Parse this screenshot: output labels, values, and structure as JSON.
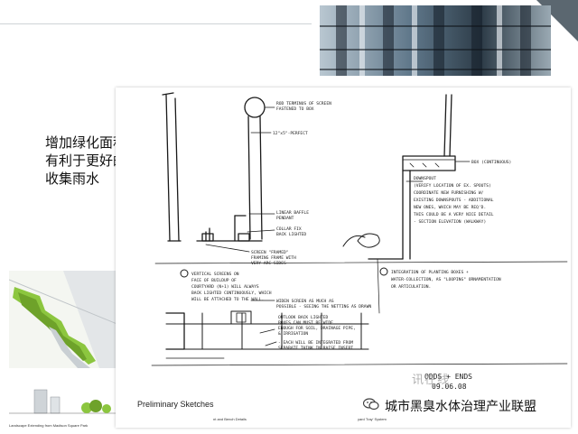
{
  "slide": {
    "caption_lines": [
      "增加绿化面积",
      "有利于更好的",
      "收集雨水"
    ],
    "sketch_notes": {
      "n1": "ROD TERMINUS OF SCREEN",
      "n1b": "FASTENED TO BOX",
      "n2": "12\"x5\"-PERFECT",
      "n3": "LINEAR BAFFLE",
      "n3b": "PENDANT",
      "n4": "COLLAR FIX",
      "n4b": "BACK LIGHTED",
      "n5": "SCREEN \"FRAMED\"",
      "n5b": "FRAMING FRAME WITH",
      "n5c": "VERY ARC SIDES",
      "n6": "BOX (CONTINUOUS)",
      "n7": "DOWNSPOUT",
      "n7b": "(VERIFY LOCATION OF EX. SPOUTS)",
      "n7c": "COORDINATE NEW FURNISHING W/",
      "n7d": "EXISTING DOWNSPOUTS - ADDITIONAL",
      "n7e": "NEW ONES, WHICH MAY BE REQ'D.",
      "n7f": "THIS COULD BE A VERY NICE DETAIL",
      "n7g": "- SECTION ELEVATION (WALKWAY)",
      "n8": "VERTICAL SCREENS ON",
      "n8b": "FACE OF BUILDUP OF",
      "n8c": "COURTYARD (N+1) WILL ALWAYS",
      "n8d": "BACK LIGHTED CONTINUOUSLY, WHICH",
      "n8e": "WILL BE ATTACHED TO THE WALL.",
      "n9": "INTEGRATION OF PLANTING BOXES +",
      "n9b": "WATER-COLLECTION, AS \"LOOPING\" ORNAMENTATION",
      "n9c": "OR ARTICULATION.",
      "n10": "WIDEN SCREEN AS MUCH AS",
      "n10b": "POSSIBLE - SEEING THE NETTING AS DRAWN",
      "n11": "OUTLOOK BACK LIGHTED",
      "n11b": "BOXES CAN MUST BE WIDE",
      "n11c": "ENOUGH FOR SOIL, DRAINAGE PIPE,",
      "n11d": "& IRRIGATION",
      "n12": "- EACH WILL BE INTEGRATED FROM",
      "n12b": "SEPARATE THINK IN RAISE INSERT",
      "sig1": "ODDS + ENDS",
      "sig2": "09.06.08"
    },
    "bottom_captions": {
      "landscape": "Landscape Extending from Madison Square Park",
      "prelim": "Preliminary Sketches",
      "detail": "nt and Bench Details",
      "tray": "yard Tray' System"
    },
    "watermark": {
      "stamp": "讯在线",
      "account_name": "城市黑臭水体治理产业联盟"
    }
  }
}
